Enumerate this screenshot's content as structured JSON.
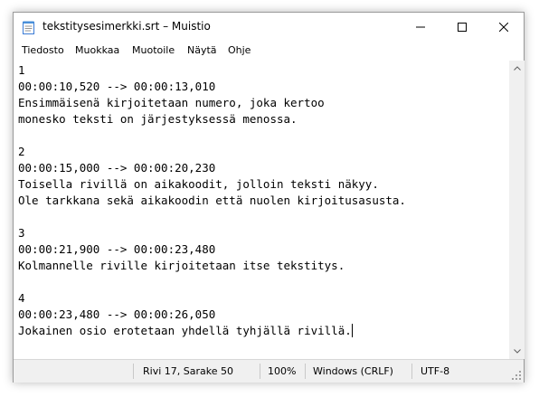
{
  "window": {
    "title": "tekstitysesimerkki.srt – Muistio",
    "icon": "notepad-icon",
    "controls": [
      "minimize-icon",
      "maximize-icon",
      "close-icon"
    ]
  },
  "menu": {
    "items": [
      "Tiedosto",
      "Muokkaa",
      "Muotoile",
      "Näytä",
      "Ohje"
    ]
  },
  "editor": {
    "lines": [
      "1",
      "00:00:10,520 --> 00:00:13,010",
      "Ensimmäisenä kirjoitetaan numero, joka kertoo",
      "monesko teksti on järjestyksessä menossa.",
      "",
      "2",
      "00:00:15,000 --> 00:00:20,230",
      "Toisella rivillä on aikakoodit, jolloin teksti näkyy.",
      "Ole tarkkana sekä aikakoodin että nuolen kirjoitusasusta.",
      "",
      "3",
      "00:00:21,900 --> 00:00:23,480",
      "Kolmannelle riville kirjoitetaan itse tekstitys.",
      "",
      "4",
      "00:00:23,480 --> 00:00:26,050",
      "Jokainen osio erotetaan yhdellä tyhjällä rivillä."
    ]
  },
  "statusbar": {
    "position": "Rivi 17, Sarake 50",
    "zoom": "100%",
    "line_endings": "Windows (CRLF)",
    "encoding": "UTF-8"
  }
}
